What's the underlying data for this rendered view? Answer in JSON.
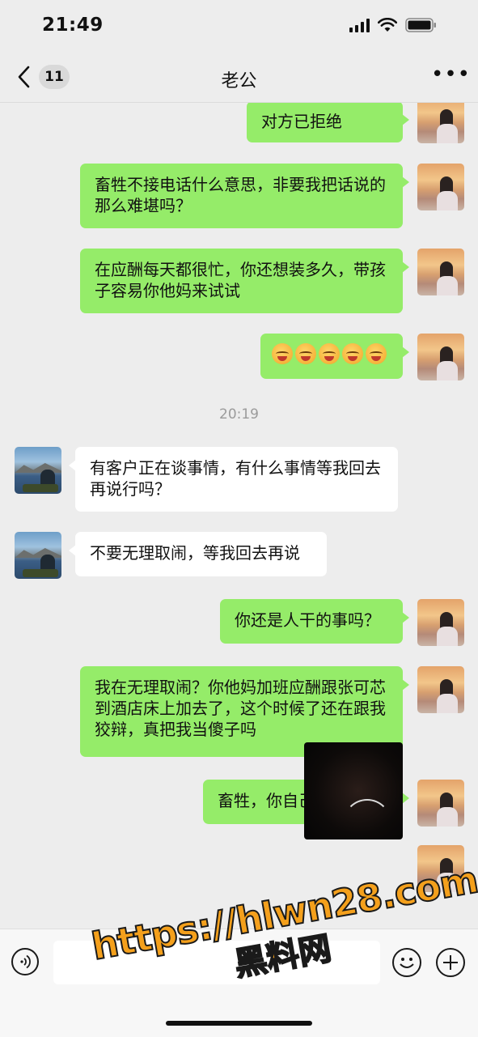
{
  "status_bar": {
    "time": "21:49"
  },
  "nav": {
    "unread_count": "11",
    "title": "老公"
  },
  "messages": [
    {
      "sender": "me",
      "text": "对方已拒绝"
    },
    {
      "sender": "me",
      "text": "畜牲不接电话什么意思，非要我把话说的那么难堪吗？"
    },
    {
      "sender": "me",
      "text": "在应酬每天都很忙，你还想装多久，带孩子容易你他妈来试试"
    },
    {
      "sender": "me",
      "type": "emoji",
      "count": 5
    },
    {
      "type": "timestamp",
      "text": "20:19"
    },
    {
      "sender": "them",
      "text": "有客户正在谈事情，有什么事情等我回去再说行吗？"
    },
    {
      "sender": "them",
      "text": "不要无理取闹，等我回去再说"
    },
    {
      "sender": "me",
      "text": "你还是人干的事吗？"
    },
    {
      "sender": "me",
      "text": "我在无理取闹？你他妈加班应酬跟张可芯到酒店床上加去了，这个时候了还在跟我狡辩，真把我当傻子吗"
    },
    {
      "sender": "me",
      "text": "畜牲，你自己看着办吧"
    },
    {
      "sender": "me",
      "type": "video"
    }
  ],
  "watermark": {
    "url": "https://hlwn28.com",
    "name": "黑料网"
  },
  "colors": {
    "my_bubble": "#95ec69",
    "their_bubble": "#ffffff",
    "background": "#ededed",
    "watermark": "#f4a01c"
  },
  "icons": [
    "back-icon",
    "more-icon",
    "voice-icon",
    "emoji-icon",
    "plus-icon",
    "video-call-icon",
    "signal-icon",
    "wifi-icon",
    "battery-icon"
  ]
}
